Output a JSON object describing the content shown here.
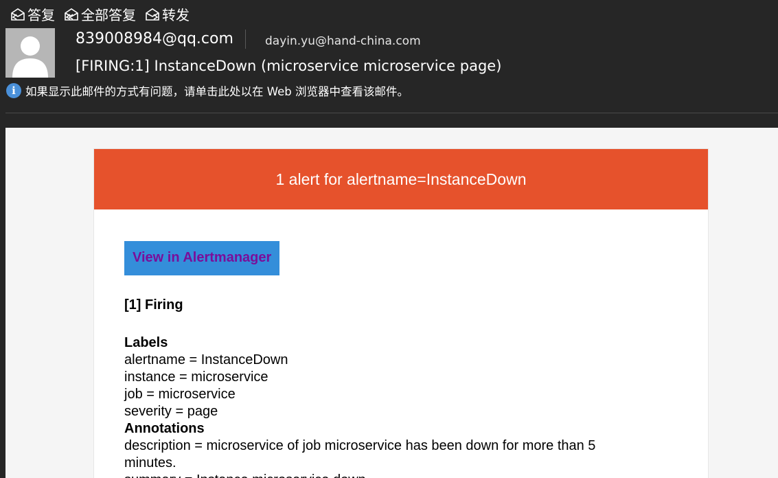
{
  "toolbar": {
    "reply_label": "答复",
    "reply_all_label": "全部答复",
    "forward_label": "转发"
  },
  "header": {
    "sender": "839008984@qq.com",
    "recipient": "dayin.yu@hand-china.com",
    "subject": "[FIRING:1] InstanceDown (microservice microservice page)",
    "info_text": "如果显示此邮件的方式有问题，请单击此处以在 Web 浏览器中查看该邮件。"
  },
  "email": {
    "alert_title": "1 alert for alertname=InstanceDown",
    "button_label": "View in Alertmanager",
    "firing_heading": "[1] Firing",
    "labels_heading": "Labels",
    "labels": [
      "alertname = InstanceDown",
      "instance = microservice",
      "job = microservice",
      "severity = page"
    ],
    "annotations_heading": "Annotations",
    "annotations": [
      "description = microservice of job microservice has been down for more than 5 minutes.",
      "summary = Instance microservice down"
    ]
  },
  "colors": {
    "alert_banner": "#e6522c",
    "button_bg": "#348eda",
    "button_text": "#7a0e9a",
    "app_bg": "#262626"
  }
}
